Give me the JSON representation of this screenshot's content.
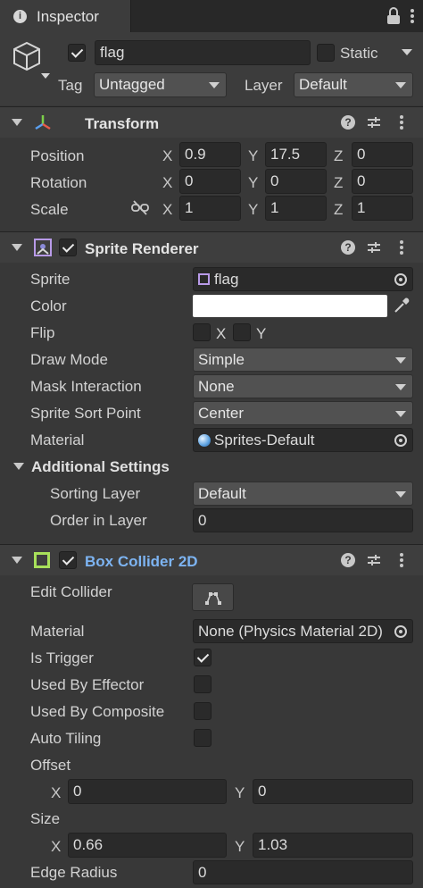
{
  "tab": {
    "title": "Inspector"
  },
  "gameobject": {
    "active": true,
    "name": "flag",
    "static_label": "Static",
    "static": false,
    "tag_label": "Tag",
    "tag_value": "Untagged",
    "layer_label": "Layer",
    "layer_value": "Default"
  },
  "transform": {
    "title": "Transform",
    "position": {
      "label": "Position",
      "x": "0.9",
      "y": "17.5",
      "z": "0"
    },
    "rotation": {
      "label": "Rotation",
      "x": "0",
      "y": "0",
      "z": "0"
    },
    "scale": {
      "label": "Scale",
      "x": "1",
      "y": "1",
      "z": "1"
    }
  },
  "axis": {
    "x": "X",
    "y": "Y",
    "z": "Z"
  },
  "sprite_renderer": {
    "title": "Sprite Renderer",
    "enabled": true,
    "sprite_label": "Sprite",
    "sprite_value": "flag",
    "color_label": "Color",
    "color_value": "#ffffff",
    "flip_label": "Flip",
    "flip_x": false,
    "flip_y": false,
    "draw_mode_label": "Draw Mode",
    "draw_mode_value": "Simple",
    "mask_interaction_label": "Mask Interaction",
    "mask_interaction_value": "None",
    "sprite_sort_point_label": "Sprite Sort Point",
    "sprite_sort_point_value": "Center",
    "material_label": "Material",
    "material_value": "Sprites-Default",
    "additional_settings_label": "Additional Settings",
    "sorting_layer_label": "Sorting Layer",
    "sorting_layer_value": "Default",
    "order_in_layer_label": "Order in Layer",
    "order_in_layer_value": "0"
  },
  "box_collider": {
    "title": "Box Collider 2D",
    "enabled": true,
    "edit_collider_label": "Edit Collider",
    "material_label": "Material",
    "material_value": "None (Physics Material 2D)",
    "is_trigger_label": "Is Trigger",
    "is_trigger": true,
    "used_by_effector_label": "Used By Effector",
    "used_by_effector": false,
    "used_by_composite_label": "Used By Composite",
    "used_by_composite": false,
    "auto_tiling_label": "Auto Tiling",
    "auto_tiling": false,
    "offset_label": "Offset",
    "offset_x": "0",
    "offset_y": "0",
    "size_label": "Size",
    "size_x": "0.66",
    "size_y": "1.03",
    "edge_radius_label": "Edge Radius",
    "edge_radius_value": "0"
  },
  "icons": {
    "tab": "info-icon",
    "lock": "lock-icon",
    "menu": "kebab-menu-icon",
    "gameobject": "cube-icon",
    "help": "help-icon",
    "presets": "sliders-icon",
    "constrain": "link-broken-icon",
    "picker": "object-picker-icon",
    "eyedropper": "eyedropper-icon",
    "edit_collider": "edit-shape-icon"
  },
  "colors": {
    "accent_link": "#7db4f2",
    "collider_icon": "#a8e05a",
    "panel": "#383838",
    "header": "#3e3e3e",
    "field": "#2a2a2a",
    "dropdown": "#515151"
  }
}
